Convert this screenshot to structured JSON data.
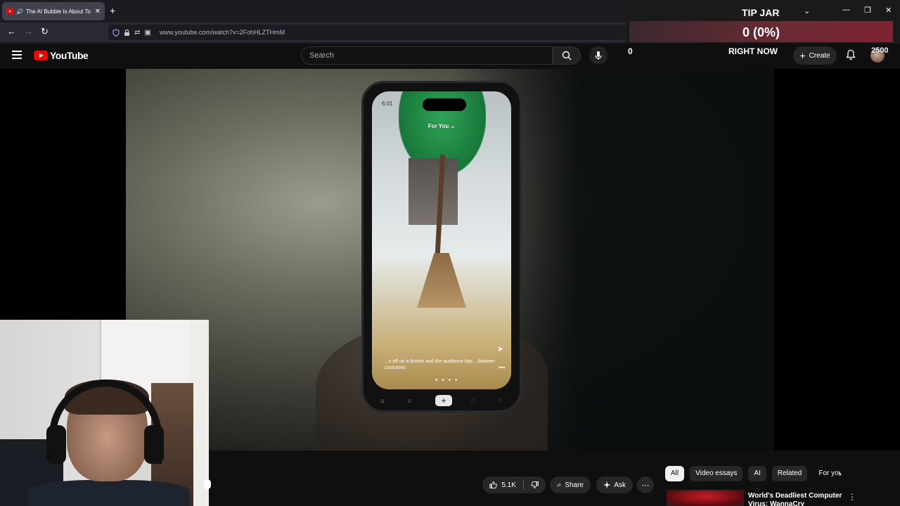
{
  "browser": {
    "tab_title": "The AI Bubble Is About To B",
    "tab_close": "✕",
    "new_tab": "+",
    "url": "www.youtube.com/watch?v=2FohHLZTHmM",
    "back": "←",
    "forward": "→",
    "reload": "↻"
  },
  "overlay": {
    "tip_jar_title": "TIP JAR",
    "tip_amount": "0 (0%)",
    "left_stat": "0",
    "right_now_label": "RIGHT NOW",
    "goal": "2500"
  },
  "youtube": {
    "logo_text": "YouTube",
    "search_placeholder": "Search",
    "create_label": "Create"
  },
  "video": {
    "phone_time": "6:01",
    "phone_feed_label": "For You ⌄",
    "phone_caption": "...s off on a broom and the audience has ...lloween costumes"
  },
  "actions": {
    "likes": "5.1K",
    "share": "Share",
    "ask": "Ask",
    "more": "⋯"
  },
  "chips": [
    "All",
    "Video essays",
    "AI",
    "Related",
    "For you"
  ],
  "recommendation": {
    "title": "World's Deadliest Computer Virus: WannaCry"
  },
  "colors": {
    "youtube_red": "#ff0000",
    "page_bg": "#0f0f0f",
    "chip_bg": "#272727",
    "tip_bar": "#7e2432"
  }
}
